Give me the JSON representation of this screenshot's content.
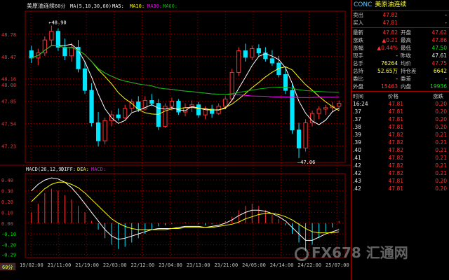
{
  "chart": {
    "header_name": "美原油连续",
    "header_period": "60分",
    "ma_label": "MA(5,10,30,60)",
    "ma5_label": "MA5:",
    "ma10_label": "MA10:",
    "ma30_label": "MA30:",
    "ma60_label": "MA60:",
    "macd_label": "MACD(26,12,9)",
    "diff_label": "DIFF:",
    "dea_label": "DEA:",
    "macd2_label": "MACD:",
    "period_button": "60分",
    "colors": {
      "up": "#ff3232",
      "down": "#00e6ff",
      "ma5": "#ffffff",
      "ma10": "#ffff00",
      "ma30": "#ff00ff",
      "ma60": "#00c000",
      "grid": "#8a0000"
    }
  },
  "chart_data": [
    {
      "type": "candlestick",
      "title": "美原油连续 60分",
      "y_ticks": [
        "48.08",
        "48.78",
        "48.47",
        "48.16",
        "47.85",
        "47.54",
        "47.23"
      ],
      "ylim": [
        47.0,
        49.1
      ],
      "high_label": "48.90",
      "low_label": "47.06",
      "x_labels": [
        "19/02:00",
        "21/11:00",
        "21/19:00",
        "22/03:00",
        "22/12:00",
        "23/04:00",
        "23/13:00",
        "23/21:00",
        "24/05:00",
        "24/14:00",
        "24/22:00",
        "25/07:00"
      ],
      "candles": [
        {
          "o": 48.55,
          "h": 48.62,
          "l": 48.38,
          "c": 48.45
        },
        {
          "o": 48.45,
          "h": 48.58,
          "l": 48.35,
          "c": 48.52
        },
        {
          "o": 48.52,
          "h": 48.75,
          "l": 48.48,
          "c": 48.7
        },
        {
          "o": 48.7,
          "h": 48.9,
          "l": 48.62,
          "c": 48.82
        },
        {
          "o": 48.82,
          "h": 48.86,
          "l": 48.55,
          "c": 48.6
        },
        {
          "o": 48.6,
          "h": 48.72,
          "l": 48.42,
          "c": 48.48
        },
        {
          "o": 48.48,
          "h": 48.66,
          "l": 48.4,
          "c": 48.6
        },
        {
          "o": 48.6,
          "h": 48.7,
          "l": 48.25,
          "c": 48.3
        },
        {
          "o": 48.3,
          "h": 48.4,
          "l": 47.95,
          "c": 48.0
        },
        {
          "o": 48.0,
          "h": 48.1,
          "l": 47.5,
          "c": 47.55
        },
        {
          "o": 47.55,
          "h": 47.7,
          "l": 47.22,
          "c": 47.3
        },
        {
          "o": 47.3,
          "h": 47.62,
          "l": 47.25,
          "c": 47.58
        },
        {
          "o": 47.58,
          "h": 47.72,
          "l": 47.5,
          "c": 47.66
        },
        {
          "o": 47.66,
          "h": 47.75,
          "l": 47.58,
          "c": 47.62
        },
        {
          "o": 47.62,
          "h": 47.8,
          "l": 47.6,
          "c": 47.75
        },
        {
          "o": 47.75,
          "h": 47.88,
          "l": 47.7,
          "c": 47.84
        },
        {
          "o": 47.84,
          "h": 47.92,
          "l": 47.7,
          "c": 47.74
        },
        {
          "o": 47.74,
          "h": 47.92,
          "l": 47.72,
          "c": 47.86
        },
        {
          "o": 47.86,
          "h": 47.95,
          "l": 47.78,
          "c": 47.82
        },
        {
          "o": 47.82,
          "h": 47.88,
          "l": 47.45,
          "c": 47.5
        },
        {
          "o": 47.5,
          "h": 47.82,
          "l": 47.48,
          "c": 47.78
        },
        {
          "o": 47.78,
          "h": 47.9,
          "l": 47.72,
          "c": 47.85
        },
        {
          "o": 47.85,
          "h": 47.88,
          "l": 47.66,
          "c": 47.7
        },
        {
          "o": 47.7,
          "h": 47.82,
          "l": 47.64,
          "c": 47.76
        },
        {
          "o": 47.76,
          "h": 47.86,
          "l": 47.7,
          "c": 47.8
        },
        {
          "o": 47.8,
          "h": 47.84,
          "l": 47.62,
          "c": 47.66
        },
        {
          "o": 47.66,
          "h": 47.78,
          "l": 47.6,
          "c": 47.74
        },
        {
          "o": 47.74,
          "h": 47.8,
          "l": 47.62,
          "c": 47.68
        },
        {
          "o": 47.68,
          "h": 47.82,
          "l": 47.66,
          "c": 47.78
        },
        {
          "o": 47.78,
          "h": 47.92,
          "l": 47.74,
          "c": 47.88
        },
        {
          "o": 47.88,
          "h": 48.3,
          "l": 47.85,
          "c": 48.25
        },
        {
          "o": 48.25,
          "h": 48.6,
          "l": 48.2,
          "c": 48.55
        },
        {
          "o": 48.55,
          "h": 48.65,
          "l": 48.4,
          "c": 48.46
        },
        {
          "o": 48.46,
          "h": 48.62,
          "l": 48.42,
          "c": 48.58
        },
        {
          "o": 48.58,
          "h": 48.64,
          "l": 48.48,
          "c": 48.52
        },
        {
          "o": 48.52,
          "h": 48.6,
          "l": 48.4,
          "c": 48.44
        },
        {
          "o": 48.44,
          "h": 48.56,
          "l": 48.34,
          "c": 48.38
        },
        {
          "o": 48.38,
          "h": 48.48,
          "l": 48.18,
          "c": 48.22
        },
        {
          "o": 48.22,
          "h": 48.3,
          "l": 47.95,
          "c": 48.0
        },
        {
          "o": 48.0,
          "h": 48.1,
          "l": 47.4,
          "c": 47.45
        },
        {
          "o": 47.45,
          "h": 47.55,
          "l": 47.06,
          "c": 47.2
        },
        {
          "o": 47.2,
          "h": 47.6,
          "l": 47.15,
          "c": 47.55
        },
        {
          "o": 47.55,
          "h": 47.72,
          "l": 47.5,
          "c": 47.68
        },
        {
          "o": 47.68,
          "h": 47.78,
          "l": 47.6,
          "c": 47.74
        },
        {
          "o": 47.74,
          "h": 47.8,
          "l": 47.66,
          "c": 47.76
        },
        {
          "o": 47.76,
          "h": 47.84,
          "l": 47.7,
          "c": 47.78
        },
        {
          "o": 47.78,
          "h": 47.86,
          "l": 47.72,
          "c": 47.82
        }
      ]
    },
    {
      "type": "macd",
      "title": "MACD(26,12,9)",
      "y_ticks": [
        "0.40",
        "0.30",
        "0.20",
        "0.10",
        "0.00",
        "-0.10",
        "-0.20",
        "-0.29"
      ],
      "ylim": [
        -0.32,
        0.46
      ],
      "histogram": [
        0.1,
        0.18,
        0.28,
        0.32,
        0.3,
        0.26,
        0.22,
        0.16,
        0.1,
        0.02,
        -0.06,
        -0.14,
        -0.2,
        -0.24,
        -0.22,
        -0.18,
        -0.14,
        -0.1,
        -0.06,
        -0.03,
        -0.02,
        -0.01,
        0.0,
        0.01,
        0.0,
        -0.01,
        -0.02,
        -0.01,
        0.0,
        0.02,
        0.06,
        0.12,
        0.16,
        0.18,
        0.16,
        0.12,
        0.08,
        0.04,
        -0.02,
        -0.1,
        -0.18,
        -0.26,
        -0.2,
        -0.14,
        -0.08,
        -0.04,
        0.02
      ],
      "diff": [
        0.3,
        0.36,
        0.4,
        0.42,
        0.41,
        0.38,
        0.33,
        0.26,
        0.18,
        0.1,
        0.02,
        -0.06,
        -0.12,
        -0.15,
        -0.14,
        -0.12,
        -0.1,
        -0.08,
        -0.06,
        -0.05,
        -0.05,
        -0.05,
        -0.04,
        -0.03,
        -0.03,
        -0.03,
        -0.04,
        -0.03,
        -0.02,
        0.0,
        0.03,
        0.07,
        0.1,
        0.12,
        0.12,
        0.11,
        0.09,
        0.06,
        0.02,
        -0.04,
        -0.1,
        -0.16,
        -0.16,
        -0.13,
        -0.1,
        -0.08,
        -0.06
      ],
      "dea": [
        0.2,
        0.26,
        0.32,
        0.36,
        0.38,
        0.38,
        0.36,
        0.33,
        0.28,
        0.22,
        0.16,
        0.1,
        0.04,
        0.0,
        -0.03,
        -0.05,
        -0.06,
        -0.06,
        -0.06,
        -0.06,
        -0.06,
        -0.05,
        -0.05,
        -0.04,
        -0.04,
        -0.04,
        -0.04,
        -0.04,
        -0.03,
        -0.02,
        -0.01,
        0.01,
        0.04,
        0.06,
        0.08,
        0.09,
        0.09,
        0.08,
        0.06,
        0.03,
        -0.01,
        -0.05,
        -0.08,
        -0.09,
        -0.09,
        -0.09,
        -0.08
      ]
    }
  ],
  "quote": {
    "code": "CONC",
    "name": "美原油连续",
    "sell_label": "卖出",
    "sell_price": "47.82",
    "sell_vol": "-",
    "buy_label": "买入",
    "buy_price": "47.81",
    "buy_vol": "-",
    "rows": [
      {
        "l1": "最新",
        "v1": "47.82",
        "l2": "开盘",
        "v2": "47.62"
      },
      {
        "l1": "涨跌",
        "v1": "▲0.21",
        "l2": "最高",
        "v2": "47.86"
      },
      {
        "l1": "涨幅",
        "v1": "▲0.44%",
        "l2": "最低",
        "v2": "47.50"
      },
      {
        "l1": "现手",
        "v1": "-",
        "l2": "昨收",
        "v2": "47.61"
      },
      {
        "l1": "总手",
        "v1": "76264",
        "l2": "均价",
        "v2": "47.75"
      },
      {
        "l1": "总持",
        "v1": "52.65万",
        "l2": "持仓差",
        "v2": "6642"
      },
      {
        "l1": "委比",
        "v1": "-",
        "l2": "委差",
        "v2": "-"
      },
      {
        "l1": "外盘",
        "v1": "15463",
        "l2": "内盘",
        "v2": "19936"
      }
    ],
    "tick_headers": {
      "time": "时间",
      "price": "价格",
      "change": "涨跌"
    },
    "ticks": [
      {
        "t": "16:24",
        "p": "47.81",
        "c": "0.20"
      },
      {
        "t": ".37",
        "p": "47.81",
        "c": "0.20"
      },
      {
        "t": ".37",
        "p": "47.81",
        "c": "0.20"
      },
      {
        "t": ".38",
        "p": "47.81",
        "c": "0.20"
      },
      {
        "t": ".39",
        "p": "47.82",
        "c": "0.21"
      },
      {
        "t": ".39",
        "p": "47.82",
        "c": "0.21"
      },
      {
        "t": ".40",
        "p": "47.82",
        "c": "0.21"
      },
      {
        "t": ".41",
        "p": "47.82",
        "c": "0.21"
      },
      {
        "t": ".42",
        "p": "47.82",
        "c": "0.21"
      },
      {
        "t": ".42",
        "p": "47.82",
        "c": "0.21"
      },
      {
        "t": ".43",
        "p": "47.81",
        "c": "0.20"
      },
      {
        "t": ".42",
        "p": "47.81",
        "c": "0.20"
      }
    ]
  },
  "watermark": {
    "text": "FX678 汇通网"
  }
}
